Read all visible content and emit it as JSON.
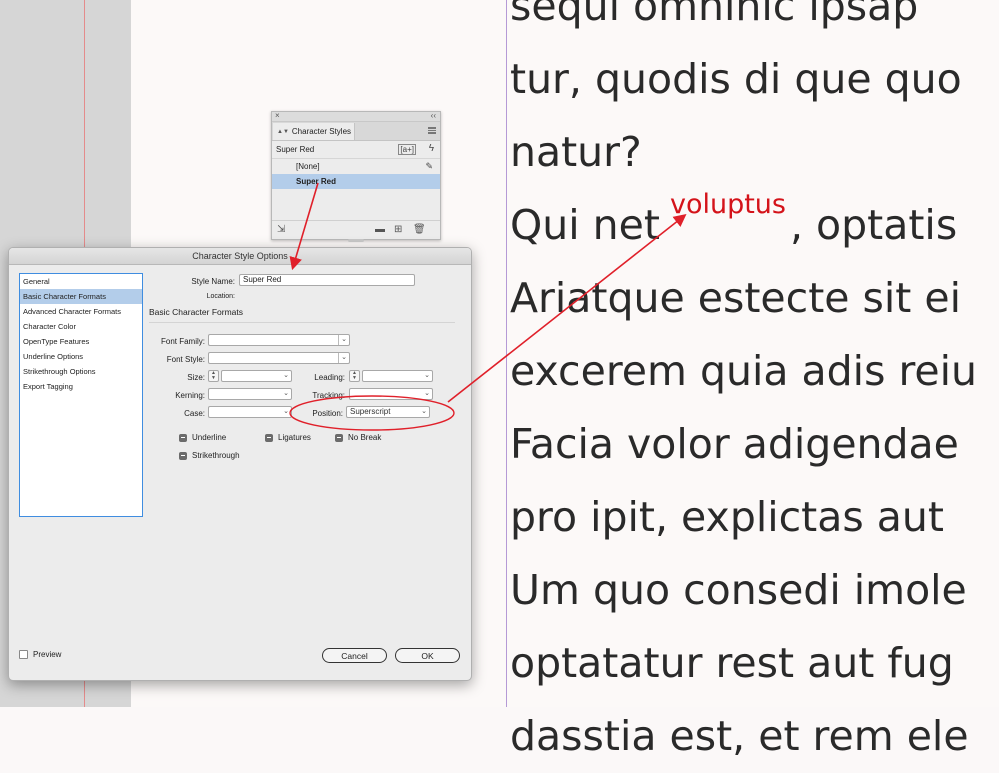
{
  "document": {
    "lines": [
      "sequi omnihic ipsap",
      "tur, quodis di que quo",
      "natur?",
      "Ariatque estecte sit ei",
      "excerem quia adis reiu",
      "Facia volor adigendae",
      "pro ipit, explictas aut",
      "Um quo consedi imole",
      "optatatur rest aut fug",
      "dasstia est, et rem ele"
    ],
    "line_qui_start": "Qui net",
    "line_qui_sup": "voluptus",
    "line_qui_end": ", optatis",
    "colors": {
      "superscript": "#d4131a",
      "annotation": "#e0202a"
    }
  },
  "char_styles_panel": {
    "close": "×",
    "collapse": "‹‹",
    "tab_label": "Character Styles",
    "current_style": "Super Red",
    "new_style_icon_text": "[a+]",
    "items": [
      {
        "label": "[None]"
      },
      {
        "label": "Super Red"
      }
    ]
  },
  "dialog": {
    "title": "Character Style Options",
    "categories": [
      "General",
      "Basic Character Formats",
      "Advanced Character Formats",
      "Character Color",
      "OpenType Features",
      "Underline Options",
      "Strikethrough Options",
      "Export Tagging"
    ],
    "style_name_label": "Style Name:",
    "style_name_value": "Super Red",
    "location_label": "Location:",
    "section_title": "Basic Character Formats",
    "font_family_label": "Font Family:",
    "font_style_label": "Font Style:",
    "size_label": "Size:",
    "leading_label": "Leading:",
    "kerning_label": "Kerning:",
    "tracking_label": "Tracking:",
    "case_label": "Case:",
    "position_label": "Position:",
    "position_value": "Superscript",
    "underline_label": "Underline",
    "ligatures_label": "Ligatures",
    "nobreak_label": "No Break",
    "strikethrough_label": "Strikethrough",
    "preview_label": "Preview",
    "cancel_label": "Cancel",
    "ok_label": "OK"
  }
}
